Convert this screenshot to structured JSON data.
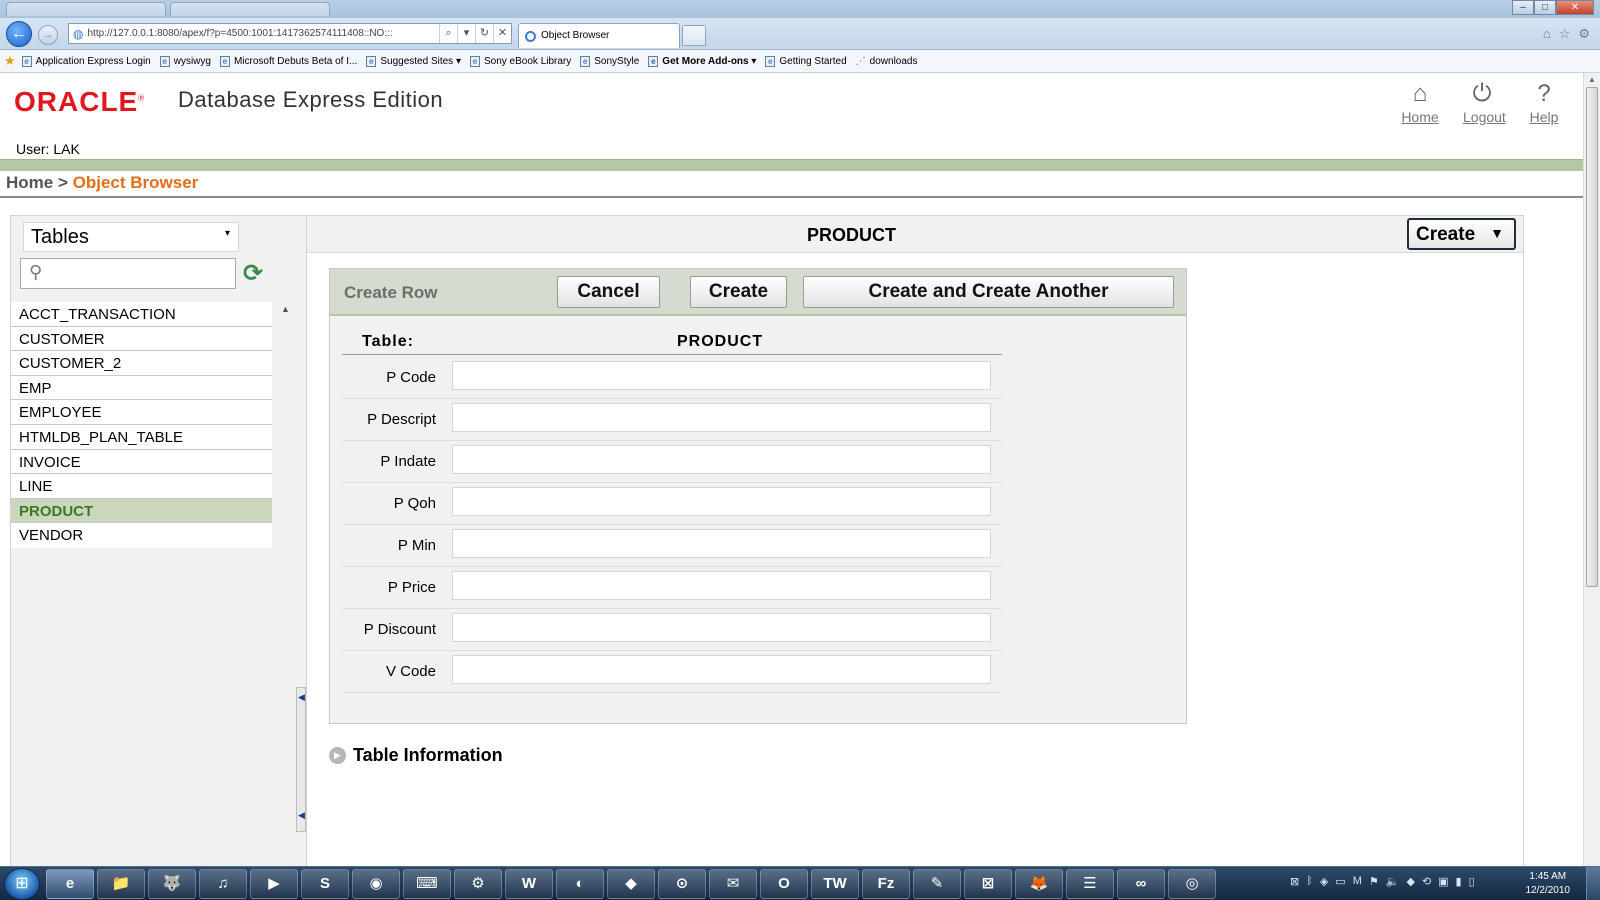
{
  "browser": {
    "address": "http://127.0.0.1:8080/apex/f?p=4500:1001:1417362574111408::NO:::",
    "active_tab": "Object Browser",
    "favorites": [
      {
        "label": "Application Express Login",
        "bold": false
      },
      {
        "label": "wysiwyg",
        "bold": false
      },
      {
        "label": "Microsoft Debuts Beta of I...",
        "bold": false
      },
      {
        "label": "Suggested Sites ▾",
        "bold": false
      },
      {
        "label": "Sony eBook Library",
        "bold": false
      },
      {
        "label": "SonyStyle",
        "bold": false
      },
      {
        "label": "Get More Add-ons ▾",
        "bold": true
      },
      {
        "label": "Getting Started",
        "bold": false
      },
      {
        "label": "downloads",
        "bold": false
      }
    ]
  },
  "header": {
    "logo": "ORACLE",
    "edition": "Database Express Edition",
    "user_line": "User: LAK",
    "nav": [
      {
        "label": "Home",
        "icon": "home-icon"
      },
      {
        "label": "Logout",
        "icon": "power-icon"
      },
      {
        "label": "Help",
        "icon": "help-icon"
      }
    ]
  },
  "breadcrumb": {
    "home": "Home",
    "separator": ">",
    "current": "Object Browser"
  },
  "sidebar": {
    "object_type": "Tables",
    "search_value": "",
    "tables": [
      {
        "name": "ACCT_TRANSACTION",
        "selected": false
      },
      {
        "name": "CUSTOMER",
        "selected": false
      },
      {
        "name": "CUSTOMER_2",
        "selected": false
      },
      {
        "name": "EMP",
        "selected": false
      },
      {
        "name": "EMPLOYEE",
        "selected": false
      },
      {
        "name": "HTMLDB_PLAN_TABLE",
        "selected": false
      },
      {
        "name": "INVOICE",
        "selected": false
      },
      {
        "name": "LINE",
        "selected": false
      },
      {
        "name": "PRODUCT",
        "selected": true
      },
      {
        "name": "VENDOR",
        "selected": false
      }
    ]
  },
  "main": {
    "object_title": "PRODUCT",
    "create_menu_label": "Create",
    "form": {
      "title": "Create Row",
      "cancel_label": "Cancel",
      "create_label": "Create",
      "create_another_label": "Create and Create Another",
      "table_label": "Table:",
      "table_name": "PRODUCT",
      "fields": [
        {
          "label": "P Code",
          "value": ""
        },
        {
          "label": "P Descript",
          "value": ""
        },
        {
          "label": "P Indate",
          "value": ""
        },
        {
          "label": "P Qoh",
          "value": ""
        },
        {
          "label": "P Min",
          "value": ""
        },
        {
          "label": "P Price",
          "value": ""
        },
        {
          "label": "P Discount",
          "value": ""
        },
        {
          "label": "V Code",
          "value": ""
        }
      ]
    },
    "table_information_label": "Table Information"
  },
  "taskbar": {
    "apps": [
      "e",
      "📁",
      "🐺",
      "♫",
      "▶",
      "S",
      "◉",
      "⌨",
      "⚙",
      "W",
      "◐",
      "◆",
      "⊙",
      "✉",
      "O",
      "TW",
      "Fz",
      "✎",
      "⊠",
      "🦊",
      "☰",
      "∞",
      "◎"
    ],
    "time": "1:45 AM",
    "date": "12/2/2010"
  },
  "colors": {
    "oracle_red": "#e2171e",
    "breadcrumb_current": "#e66d19",
    "header_green": "#b4c9a3",
    "selected_row_bg": "#cad7bd",
    "selected_row_text": "#3a7a22"
  }
}
